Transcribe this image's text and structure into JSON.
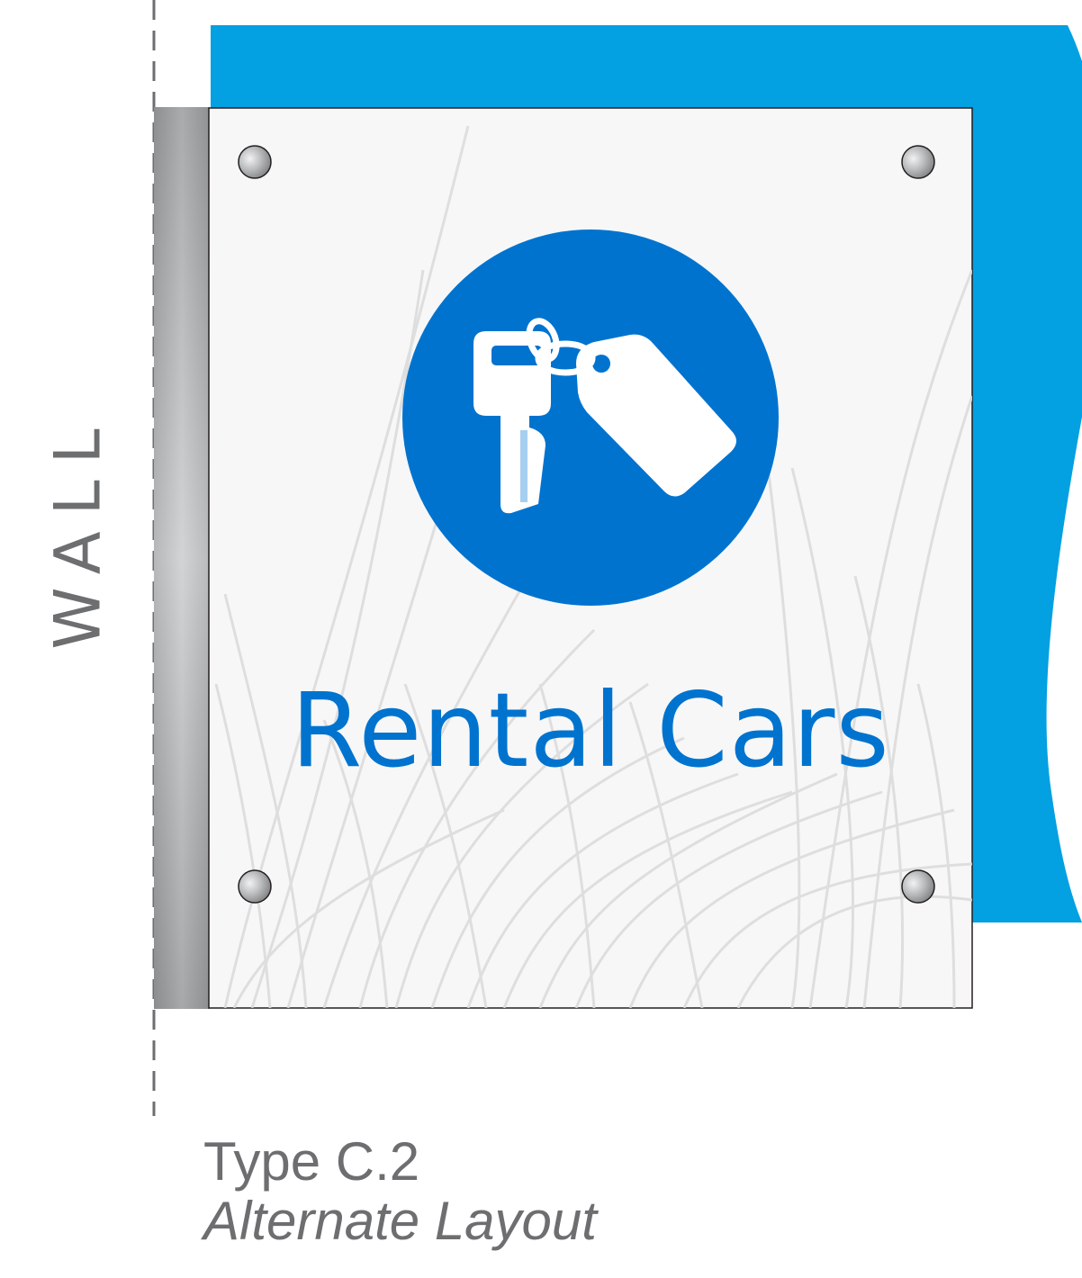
{
  "wall_label": "WALL",
  "sign": {
    "title": "Rental Cars",
    "icon": "car-key-with-tag-icon",
    "icon_circle_color": "#0073cf",
    "text_color": "#0073cf",
    "panel_color": "#f7f7f7"
  },
  "backdrop_color": "#03a0e2",
  "caption": {
    "type": "Type C.2",
    "layout": "Alternate Layout"
  }
}
